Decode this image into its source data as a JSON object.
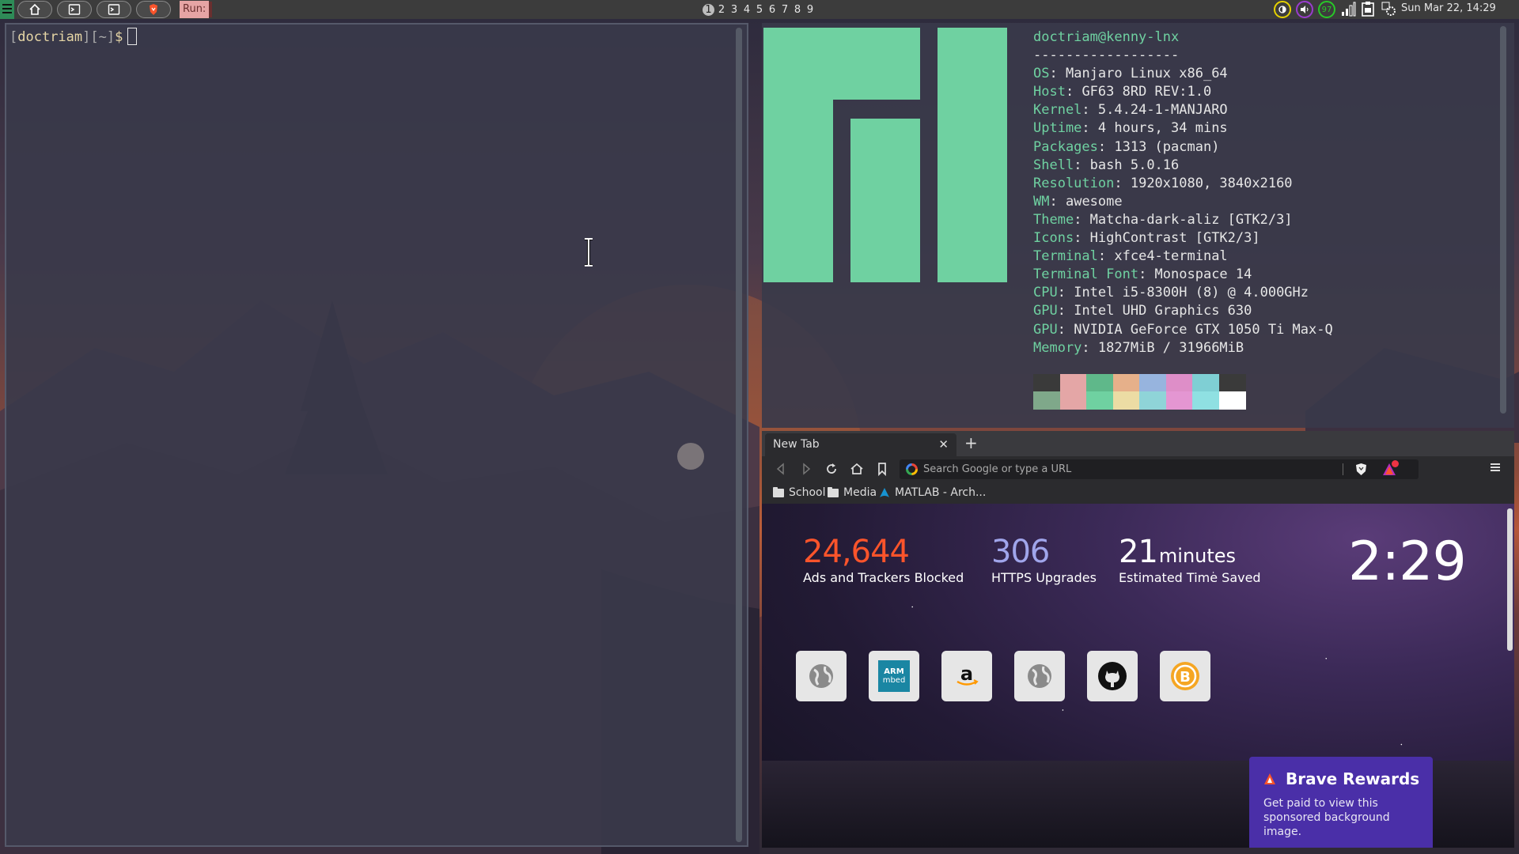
{
  "topbar": {
    "run_label": "Run:",
    "tags": [
      "1",
      "2",
      "3",
      "4",
      "5",
      "6",
      "7",
      "8",
      "9"
    ],
    "active_tag": "1",
    "battery_text": "97",
    "clock": "Sun Mar 22, 14:29",
    "colors": {
      "run_bg": "#e6a4a4",
      "launcher": "#2e8b57",
      "indicator_yellow": "#e6d200",
      "indicator_purple": "#9a3ccf",
      "indicator_green": "#28c828"
    }
  },
  "terminal_left": {
    "prompt_user": "doctriam",
    "prompt_dir": "~",
    "prompt_symbol": "$"
  },
  "neofetch": {
    "title": "doctriam@kenny-lnx",
    "divider": "------------------",
    "fields": [
      {
        "k": "OS",
        "v": "Manjaro Linux x86_64"
      },
      {
        "k": "Host",
        "v": "GF63 8RD REV:1.0"
      },
      {
        "k": "Kernel",
        "v": "5.4.24-1-MANJARO"
      },
      {
        "k": "Uptime",
        "v": "4 hours, 34 mins"
      },
      {
        "k": "Packages",
        "v": "1313 (pacman)"
      },
      {
        "k": "Shell",
        "v": "bash 5.0.16"
      },
      {
        "k": "Resolution",
        "v": "1920x1080, 3840x2160"
      },
      {
        "k": "WM",
        "v": "awesome"
      },
      {
        "k": "Theme",
        "v": "Matcha-dark-aliz [GTK2/3]"
      },
      {
        "k": "Icons",
        "v": "HighContrast [GTK2/3]"
      },
      {
        "k": "Terminal",
        "v": "xfce4-terminal"
      },
      {
        "k": "Terminal Font",
        "v": "Monospace 14"
      },
      {
        "k": "CPU",
        "v": "Intel i5-8300H (8) @ 4.000GHz"
      },
      {
        "k": "GPU",
        "v": "Intel UHD Graphics 630"
      },
      {
        "k": "GPU",
        "v": "NVIDIA GeForce GTX 1050 Ti Max-Q"
      },
      {
        "k": "Memory",
        "v": "1827MiB / 31966MiB"
      }
    ],
    "palette_top": [
      "#3a3a3a",
      "#e4a6a6",
      "#5fb88a",
      "#e6b08a",
      "#97b4de",
      "#de8ec8",
      "#7fcfd4",
      "#3a3a3a"
    ],
    "palette_bottom": [
      "#7fa88a",
      "#e4a6a6",
      "#6fd1a1",
      "#ecdca4",
      "#8fd4d8",
      "#e496d2",
      "#8fe0e2",
      "#ffffff"
    ],
    "accent": "#6fd1a1"
  },
  "browser": {
    "tab_title": "New Tab",
    "url_placeholder": "Search Google or type a URL",
    "bookmarks": [
      "School",
      "Media",
      "MATLAB - Arch..."
    ],
    "stats": [
      {
        "value": "24,644",
        "unit": "",
        "label": "Ads and Trackers Blocked",
        "color": "#fb542b"
      },
      {
        "value": "306",
        "unit": "",
        "label": "HTTPS Upgrades",
        "color": "#a0a5eb"
      },
      {
        "value": "21",
        "unit": "minutes",
        "label": "Estimated Time Saved",
        "color": "#ffffff"
      }
    ],
    "clock": "2:29",
    "tiles": [
      "globe-icon",
      "arm-mbed-icon",
      "amazon-icon",
      "globe-icon",
      "github-icon",
      "brave-icon"
    ],
    "rewards": {
      "title": "Brave Rewards",
      "desc": "Get paid to view this sponsored background image."
    }
  }
}
